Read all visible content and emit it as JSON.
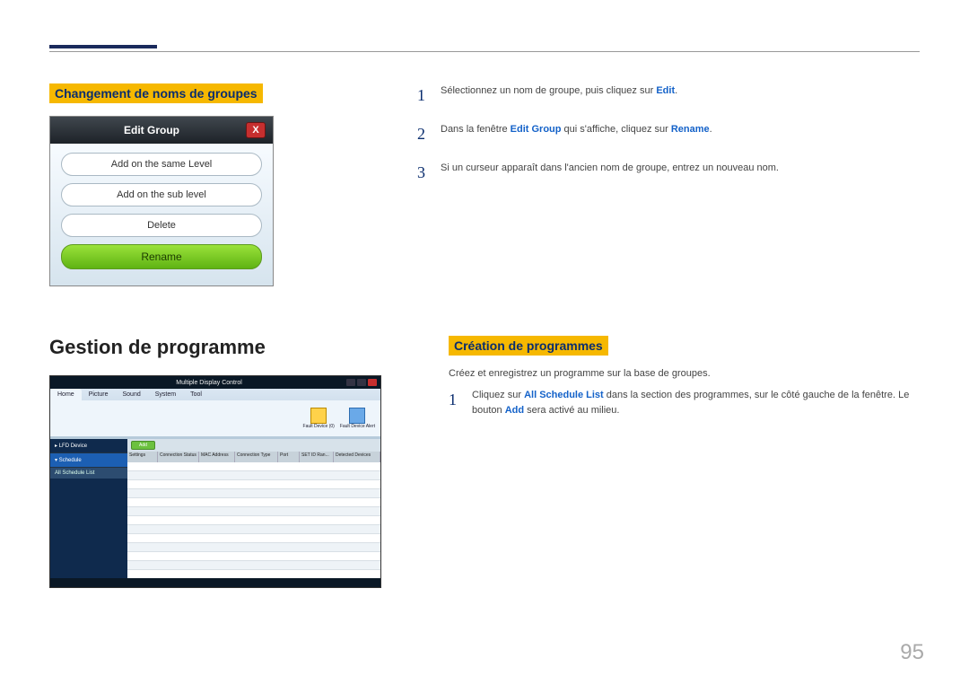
{
  "topSection": {
    "left": {
      "heading": "Changement de noms de groupes",
      "dialog": {
        "title": "Edit Group",
        "buttons": {
          "sameLevel": "Add on the same Level",
          "subLevel": "Add on the sub level",
          "delete": "Delete",
          "rename": "Rename"
        }
      }
    },
    "right": {
      "steps": [
        {
          "num": "1",
          "pre": "Sélectionnez un nom de groupe, puis cliquez sur ",
          "kw": "Edit",
          "post": "."
        },
        {
          "num": "2",
          "pre": "Dans la fenêtre ",
          "kw1": "Edit Group",
          "mid": " qui s'affiche, cliquez sur ",
          "kw2": "Rename",
          "post": "."
        },
        {
          "num": "3",
          "pre": "Si un curseur apparaît dans l'ancien nom de groupe, entrez un nouveau nom."
        }
      ]
    }
  },
  "bottomSection": {
    "left": {
      "heading": "Gestion de programme",
      "app": {
        "title": "Multiple Display Control",
        "tabs": {
          "home": "Home",
          "picture": "Picture",
          "sound": "Sound",
          "system": "System",
          "tool": "Tool"
        },
        "ribbon": {
          "faultDeviceId": "Fault Device\n(0)",
          "faultDeviceAlert": "Fault Device\nAlert"
        },
        "sidebar": {
          "lfd": "LFD Device",
          "schedule": "Schedule",
          "allSchedule": "All Schedule List"
        },
        "addBtn": "Add",
        "gridHeaders": {
          "settings": "Settings",
          "connStatus": "Connection Status",
          "mac": "MAC Address",
          "connType": "Connection Type",
          "port": "Port",
          "setId": "SET ID Ran...",
          "detected": "Detected Devices"
        }
      }
    },
    "right": {
      "heading": "Création de programmes",
      "intro": "Créez et enregistrez un programme sur la base de groupes.",
      "step1": {
        "num": "1",
        "pre": "Cliquez sur ",
        "kw1": "All Schedule List",
        "mid": " dans la section des programmes, sur le côté gauche de la fenêtre. Le bouton ",
        "kw2": "Add",
        "post": " sera activé au milieu."
      }
    }
  },
  "pageNumber": "95"
}
